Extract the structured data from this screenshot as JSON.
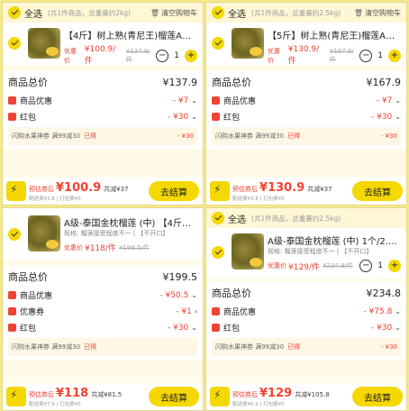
{
  "panels": [
    {
      "select_all": "全选",
      "info": "(共1件商品，总重量约2kg)",
      "clear": "清空购物车",
      "item_title": "【4斤】树上熟(青尼王)榴莲AAA 1.…",
      "item_spec": "",
      "coupon_label": "优惠价",
      "price": "¥100.9/件",
      "orig": "¥137.9/件",
      "qty": "1",
      "total_label": "商品总价",
      "total": "¥137.9",
      "lines": [
        {
          "label": "商品优惠",
          "value": "- ¥7"
        },
        {
          "label": "红包",
          "value": "- ¥30"
        }
      ],
      "coupon_text": "闪购水果神券 满99减30",
      "coupon_used": "已得",
      "coupon_value": "- ¥30",
      "est_label": "预估券后",
      "est": "¥100.9",
      "saved": "共减¥37",
      "ship": "配送费¥3.8 | 打包费¥0",
      "checkout": "去结算"
    },
    {
      "select_all": "全选",
      "info": "(共1件商品，总重量约2.5kg)",
      "clear": "清空购物车",
      "item_title": "【5斤】树上熟(青尼王)榴莲AAA 2.…",
      "item_spec": "",
      "coupon_label": "优惠价",
      "price": "¥130.9/件",
      "orig": "¥167.9/件",
      "qty": "1",
      "total_label": "商品总价",
      "total": "¥167.9",
      "lines": [
        {
          "label": "商品优惠",
          "value": "- ¥7"
        },
        {
          "label": "红包",
          "value": "- ¥30"
        }
      ],
      "coupon_text": "闪购水果神券 满99减30",
      "coupon_used": "已得",
      "coupon_value": "- ¥30",
      "est_label": "预估券后",
      "est": "¥130.9",
      "saved": "共减¥37",
      "ship": "配送费¥3.8 | 打包费¥0",
      "checkout": "去结算"
    },
    {
      "select_all": "",
      "info": "",
      "clear": "",
      "item_title": "A级-泰国金枕榴莲 (中) 【4斤可剥…",
      "item_spec": "规格: 榴莲接受程度不一 | 【不开口】",
      "coupon_label": "优惠价",
      "price": "¥118/件",
      "orig": "¥199.5/件",
      "qty": "",
      "total_label": "商品总价",
      "total": "¥199.5",
      "lines": [
        {
          "label": "商品优惠",
          "value": "- ¥50.5"
        },
        {
          "label": "优惠券",
          "value": "- ¥1"
        },
        {
          "label": "红包",
          "value": "- ¥30"
        }
      ],
      "coupon_text": "闪购水果神券 满99减30",
      "coupon_used": "已得",
      "coupon_value": "",
      "est_label": "预估券后",
      "est": "¥118",
      "saved": "共减¥81.5",
      "ship": "配送费¥7.9 | 打包费¥0",
      "checkout": "去结算"
    },
    {
      "select_all": "全选",
      "info": "(共1件商品，总重量约2.5kg)",
      "clear": "",
      "item_title": "A级-泰国金枕榴莲 (中) 1个/2.3-…",
      "item_spec": "规格: 榴莲接受程度不一 | 【不开口】",
      "coupon_label": "优惠价",
      "price": "¥129/件",
      "orig": "¥234.8/件",
      "qty": "1",
      "total_label": "商品总价",
      "total": "¥234.8",
      "lines": [
        {
          "label": "商品优惠",
          "value": "- ¥75.8"
        },
        {
          "label": "红包",
          "value": "- ¥30"
        }
      ],
      "coupon_text": "闪购水果神券 满99减30",
      "coupon_used": "已得",
      "coupon_value": "- ¥30",
      "est_label": "预估券后",
      "est": "¥129",
      "saved": "共减¥105.8",
      "ship": "配送费¥6.9 | 打包费¥0",
      "checkout": "去结算"
    }
  ],
  "colors": {
    "accent": "#f5d800",
    "discount": "#e43",
    "bg": "#f6e98a"
  }
}
